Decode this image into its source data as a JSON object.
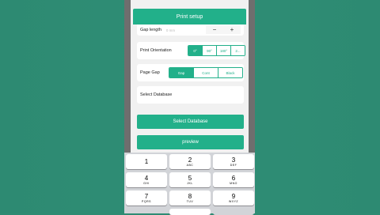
{
  "header": {
    "title": "Print setup"
  },
  "gap": {
    "label": "Gap length",
    "placeholder": "0 mm",
    "minus": "−",
    "plus": "+"
  },
  "orientation": {
    "label": "Print Orientation",
    "options": [
      "0°",
      "90°",
      "180°",
      "2..."
    ],
    "selected": 0
  },
  "page_gap": {
    "label": "Page Gap",
    "options": [
      "Gap",
      "Cont",
      "Black"
    ],
    "selected": 0
  },
  "database": {
    "label": "Select Database"
  },
  "buttons": {
    "select_database": "Select Database",
    "preview": "preview"
  },
  "keyboard": {
    "keys": [
      {
        "d": "1",
        "l": ""
      },
      {
        "d": "2",
        "l": "ABC"
      },
      {
        "d": "3",
        "l": "DEF"
      },
      {
        "d": "4",
        "l": "GHI"
      },
      {
        "d": "5",
        "l": "JKL"
      },
      {
        "d": "6",
        "l": "MNO"
      },
      {
        "d": "7",
        "l": "PQRS"
      },
      {
        "d": "8",
        "l": "TUV"
      },
      {
        "d": "9",
        "l": "WXYZ"
      }
    ]
  },
  "colors": {
    "accent": "#22b08a",
    "background": "#2e8b73"
  }
}
